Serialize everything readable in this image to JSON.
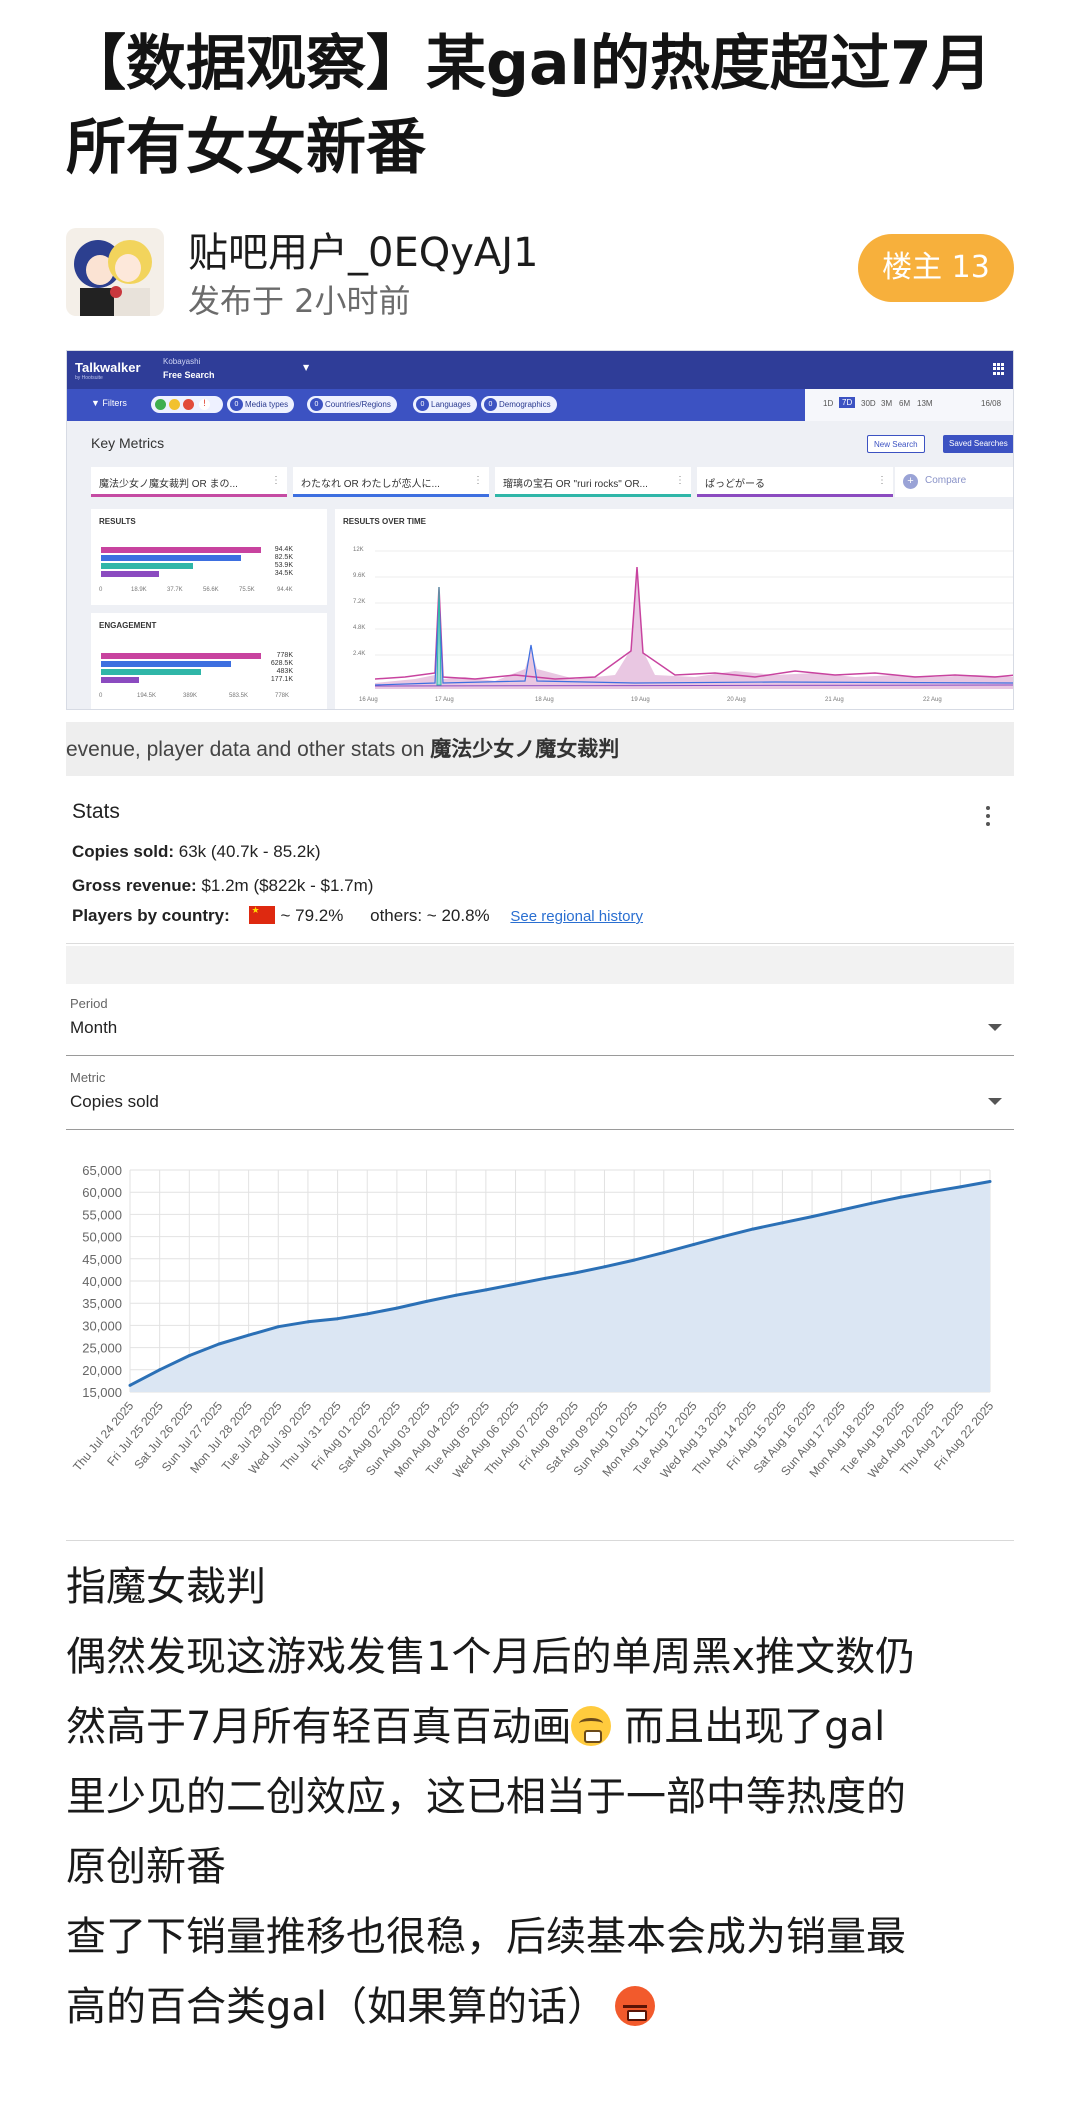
{
  "post": {
    "title": "【数据观察】某gal的热度超过7月所有女女新番",
    "author": "贴吧用户_0EQyAJ1",
    "time": "发布于 2小时前",
    "badge": "楼主 13"
  },
  "talkwalker": {
    "logo": "Talkwalker",
    "logo_sub": "by Hootsuite",
    "user": "Kobayashi",
    "search_name": "Free Search",
    "filters_label": "Filters",
    "pills": [
      "Media types",
      "Countries/Regions",
      "Languages",
      "Demographics"
    ],
    "ranges": [
      "1D",
      "7D",
      "30D",
      "3M",
      "6M",
      "13M"
    ],
    "selected_range": "7D",
    "date": "16/08",
    "key_metrics": "Key Metrics",
    "new_search": "New Search",
    "saved_searches": "Saved Searches",
    "queries": [
      "魔法少女ノ魔女裁判 OR まの...",
      "わたなれ OR わたしが恋人に...",
      "瑠璃の宝石 OR \"ruri rocks\" OR...",
      "ぱっどがーる"
    ],
    "compare": "Compare",
    "results_title": "RESULTS",
    "results_values": [
      "94.4K",
      "82.5K",
      "53.9K",
      "34.5K"
    ],
    "results_ticks": [
      "0",
      "18.9K",
      "37.7K",
      "56.6K",
      "75.5K",
      "94.4K"
    ],
    "engagement_title": "ENGAGEMENT",
    "engagement_values": [
      "778K",
      "628.5K",
      "483K",
      "177.1K"
    ],
    "engagement_ticks": [
      "0",
      "194.5K",
      "389K",
      "583.5K",
      "778K"
    ],
    "rot_title": "RESULTS OVER TIME",
    "rot_yticks": [
      "12K",
      "9.6K",
      "7.2K",
      "4.8K",
      "2.4K"
    ],
    "rot_xticks": [
      "16 Aug",
      "17 Aug",
      "18 Aug",
      "19 Aug",
      "20 Aug",
      "21 Aug",
      "22 Aug"
    ],
    "colors": {
      "magenta": "#c8439f",
      "blue": "#3d6fe0",
      "teal": "#2fb6a8",
      "purple": "#8b4bc0"
    }
  },
  "search_strip": {
    "prefix": "evenue, player data and other stats on ",
    "game": "魔法少女ノ魔女裁判"
  },
  "stats": {
    "title": "Stats",
    "copies_label": "Copies sold:",
    "copies_value": "63k (40.7k - 85.2k)",
    "revenue_label": "Gross revenue:",
    "revenue_value": "$1.2m ($822k - $1.7m)",
    "country_label": "Players by country:",
    "china_share": "~ 79.2%",
    "others_share": "others: ~ 20.8%",
    "regional_link": "See regional history"
  },
  "period": {
    "label": "Period",
    "value": "Month"
  },
  "metric": {
    "label": "Metric",
    "value": "Copies sold"
  },
  "chart_data": {
    "type": "area",
    "title": "",
    "xlabel": "",
    "ylabel": "",
    "ylim": [
      15000,
      65000
    ],
    "y_ticks": [
      "65,000",
      "60,000",
      "55,000",
      "50,000",
      "45,000",
      "40,000",
      "35,000",
      "30,000",
      "25,000",
      "20,000",
      "15,000"
    ],
    "x": [
      "Thu Jul 24 2025",
      "Fri Jul 25 2025",
      "Sat Jul 26 2025",
      "Sun Jul 27 2025",
      "Mon Jul 28 2025",
      "Tue Jul 29 2025",
      "Wed Jul 30 2025",
      "Thu Jul 31 2025",
      "Fri Aug 01 2025",
      "Sat Aug 02 2025",
      "Sun Aug 03 2025",
      "Mon Aug 04 2025",
      "Tue Aug 05 2025",
      "Wed Aug 06 2025",
      "Thu Aug 07 2025",
      "Fri Aug 08 2025",
      "Sat Aug 09 2025",
      "Sun Aug 10 2025",
      "Mon Aug 11 2025",
      "Tue Aug 12 2025",
      "Wed Aug 13 2025",
      "Thu Aug 14 2025",
      "Fri Aug 15 2025",
      "Sat Aug 16 2025",
      "Sun Aug 17 2025",
      "Mon Aug 18 2025",
      "Tue Aug 19 2025",
      "Wed Aug 20 2025",
      "Thu Aug 21 2025",
      "Fri Aug 22 2025"
    ],
    "series": [
      {
        "values": [
          16500,
          20000,
          23200,
          25800,
          27800,
          29700,
          30800,
          31500,
          32600,
          33900,
          35400,
          36800,
          38000,
          39300,
          40600,
          41800,
          43200,
          44700,
          46400,
          48200,
          50000,
          51700,
          53100,
          54500,
          56000,
          57500,
          58900,
          60100,
          61200,
          62400
        ]
      }
    ],
    "line_color": "#2b70b6",
    "fill_color": "#dbe6f3",
    "grid": true
  },
  "body": {
    "line1": "指魔女裁判",
    "line2": "偶然发现这游戏发售1个月后的单周黑x推文数仍",
    "line3a": "然高于7月所有轻百真百动画",
    "line3b": " 而且出现了gal",
    "line4": "里少见的二创效应，这已相当于一部中等热度的",
    "line5": "原创新番",
    "line6": "查了下销量推移也很稳，后续基本会成为销量最",
    "line7": "高的百合类gal（如果算的话）",
    "emoji1": "sweat-emoji",
    "emoji2": "angry-emoji"
  }
}
